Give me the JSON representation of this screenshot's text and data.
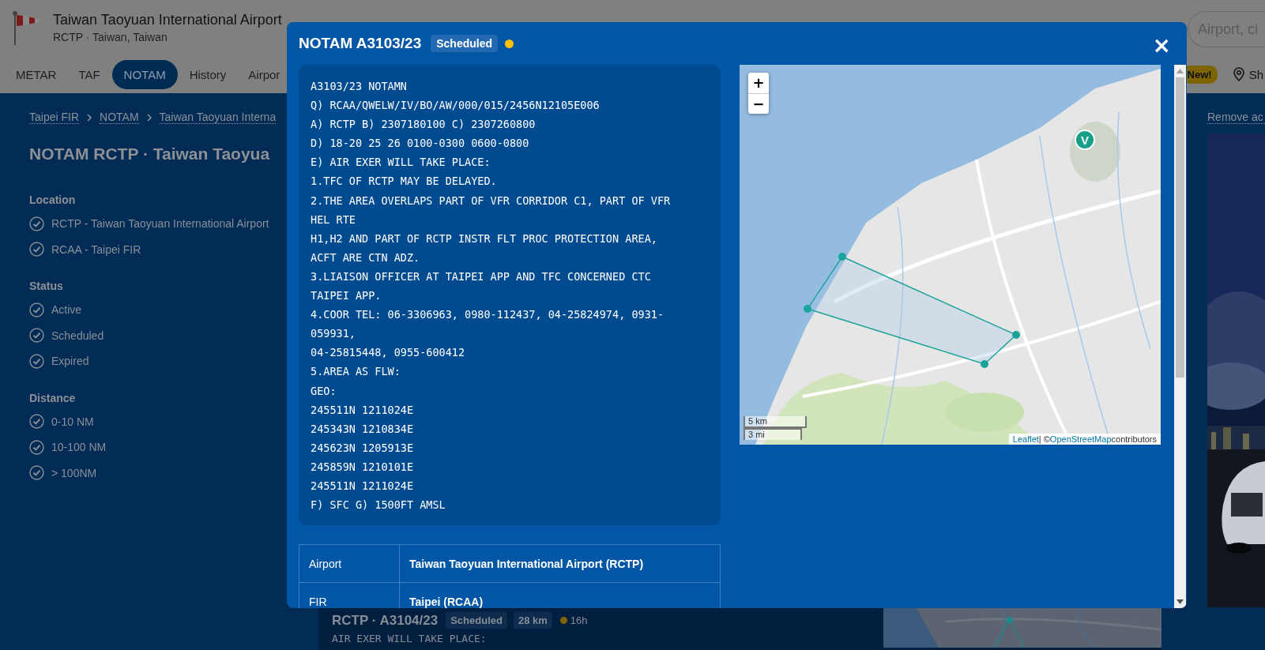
{
  "header": {
    "airport_name": "Taiwan Taoyuan International Airport",
    "subtitle": "RCTP · Taiwan, Taiwan",
    "search": {
      "placeholder": "Airport, ci"
    },
    "new_badge": "New!",
    "nearby_label": "Sh"
  },
  "nav_tabs": [
    {
      "label": "METAR",
      "selected": false
    },
    {
      "label": "TAF",
      "selected": false
    },
    {
      "label": "NOTAM",
      "selected": true
    },
    {
      "label": "History",
      "selected": false
    },
    {
      "label": "Airpor",
      "selected": false
    }
  ],
  "breadcrumb": [
    "Taipei FIR",
    "NOTAM",
    "Taiwan Taoyuan Interna"
  ],
  "page_title": "NOTAM RCTP · Taiwan Taoyua",
  "filters": [
    {
      "title": "Location",
      "items": [
        {
          "label": "RCTP - Taiwan Taoyuan International Airport",
          "checked": true
        },
        {
          "label": "RCAA - Taipei FIR",
          "checked": true
        }
      ]
    },
    {
      "title": "Status",
      "items": [
        {
          "label": "Active",
          "checked": true
        },
        {
          "label": "Scheduled",
          "checked": true
        },
        {
          "label": "Expired",
          "checked": true
        }
      ]
    },
    {
      "title": "Distance",
      "items": [
        {
          "label": "0-10 NM",
          "checked": true
        },
        {
          "label": "10-100 NM",
          "checked": true
        },
        {
          "label": "> 100NM",
          "checked": true
        }
      ]
    }
  ],
  "ad": {
    "remove_link": "Remove ac"
  },
  "notam_card": {
    "title": "RCTP · A3104/23",
    "status": "Scheduled",
    "distance": "28 km",
    "age": "16h",
    "text": "AIR EXER WILL TAKE PLACE:"
  },
  "modal": {
    "title": "NOTAM A3103/23",
    "status": "Scheduled",
    "close": "×",
    "notam_lines": [
      "A3103/23 NOTAMN",
      "Q) RCAA/QWELW/IV/BO/AW/000/015/2456N12105E006",
      "A) RCTP B) 2307180100 C) 2307260800",
      "D) 18-20 25 26 0100-0300 0600-0800",
      "E) AIR EXER WILL TAKE PLACE:",
      "1.TFC OF RCTP MAY BE DELAYED.",
      "2.THE AREA OVERLAPS PART OF VFR CORRIDOR C1, PART OF VFR",
      "HEL RTE",
      "H1,H2 AND PART OF RCTP INSTR FLT PROC PROTECTION AREA,",
      "ACFT ARE CTN ADZ.",
      "3.LIAISON OFFICER AT TAIPEI APP AND TFC CONCERNED CTC",
      "TAIPEI APP.",
      "4.COOR TEL: 06-3306963, 0980-112437, 04-25824974, 0931-",
      "059931,",
      "04-25815448, 0955-600412",
      "5.AREA AS FLW:",
      "GEO:",
      "245511N 1211024E",
      "245343N 1210834E",
      "245623N 1205913E",
      "245859N 1210101E",
      "245511N 1211024E",
      "F) SFC G) 1500FT AMSL"
    ],
    "map": {
      "zoom_in": "+",
      "zoom_out": "−",
      "scale": [
        "5 km",
        "3 mi"
      ],
      "marker_label": "V",
      "attribution": [
        {
          "kind": "link",
          "text": "Leaflet"
        },
        {
          "kind": "text",
          "text": "| ©"
        },
        {
          "kind": "link",
          "text": "OpenStreetMap"
        },
        {
          "kind": "text",
          "text": "contributors"
        }
      ]
    },
    "details": [
      {
        "label": "Airport",
        "value": "Taiwan Taoyuan International Airport (RCTP)"
      },
      {
        "label": "FIR",
        "value": "Taipei (RCAA)"
      }
    ]
  }
}
